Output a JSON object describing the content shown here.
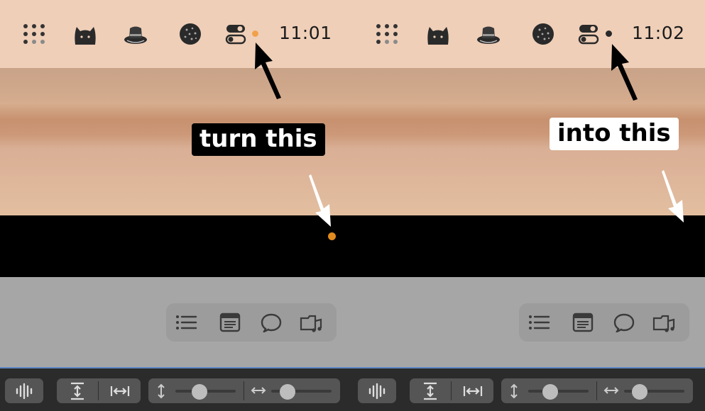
{
  "colors": {
    "status_dot_before": "#f2a14a",
    "status_dot_after": "#2a2a2a",
    "callout_dot": "#e08a1e",
    "bottom_bar_border": "#5e86c4"
  },
  "left_panel": {
    "menubar": {
      "icons": [
        "grid-dots-icon",
        "cat-icon",
        "hat-icon",
        "cookie-icon",
        "toggle-switches-icon"
      ],
      "time": "11:01"
    },
    "annotation": "turn this"
  },
  "right_panel": {
    "menubar": {
      "icons": [
        "grid-dots-icon",
        "cat-icon",
        "hat-icon",
        "cookie-icon",
        "toggle-switches-icon"
      ],
      "time": "11:02"
    },
    "annotation": "into this"
  },
  "toolbar_icons": [
    "list-icon",
    "document-icon",
    "speech-bubble-icon",
    "media-files-icon"
  ],
  "bottom_controls": [
    "waveform-icon",
    "vertical-expand-icon",
    "horizontal-expand-icon",
    "vertical-arrows-icon",
    "vertical-zoom-slider",
    "horizontal-arrows-icon",
    "horizontal-zoom-slider"
  ]
}
